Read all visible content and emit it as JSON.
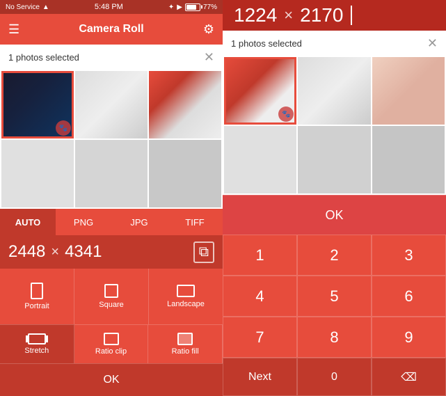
{
  "left": {
    "status": {
      "service": "No Service",
      "time": "5:48 PM",
      "battery": "77%"
    },
    "header": {
      "title": "Camera Roll",
      "menu_label": "☰",
      "settings_label": "⚙"
    },
    "selection_bar": {
      "text": "1 photos selected",
      "close_label": "✕"
    },
    "format_tabs": [
      {
        "label": "AUTO",
        "active": true
      },
      {
        "label": "PNG",
        "active": false
      },
      {
        "label": "JPG",
        "active": false
      },
      {
        "label": "TIFF",
        "active": false
      }
    ],
    "dimensions": {
      "width": "2448",
      "x": "×",
      "height": "4341"
    },
    "layout_buttons": [
      {
        "label": "Portrait",
        "icon": "portrait-icon"
      },
      {
        "label": "Square",
        "icon": "square-icon"
      },
      {
        "label": "Landscape",
        "icon": "landscape-icon"
      }
    ],
    "layout_buttons2": [
      {
        "label": "Stretch",
        "icon": "stretch-icon"
      },
      {
        "label": "Ratio clip",
        "icon": "ratio-clip-icon"
      },
      {
        "label": "Ratio fill",
        "icon": "ratio-fill-icon"
      }
    ],
    "ok_label": "OK"
  },
  "right": {
    "display": {
      "width": "1224",
      "x": "×",
      "height": "2170"
    },
    "selection_bar": {
      "text": "1 photos selected",
      "close_label": "✕"
    },
    "ok_label": "OK",
    "numpad": {
      "rows": [
        [
          "1",
          "2",
          "3"
        ],
        [
          "4",
          "5",
          "6"
        ],
        [
          "7",
          "8",
          "9"
        ]
      ],
      "bottom": [
        "Next",
        "0",
        "⌫"
      ]
    }
  }
}
